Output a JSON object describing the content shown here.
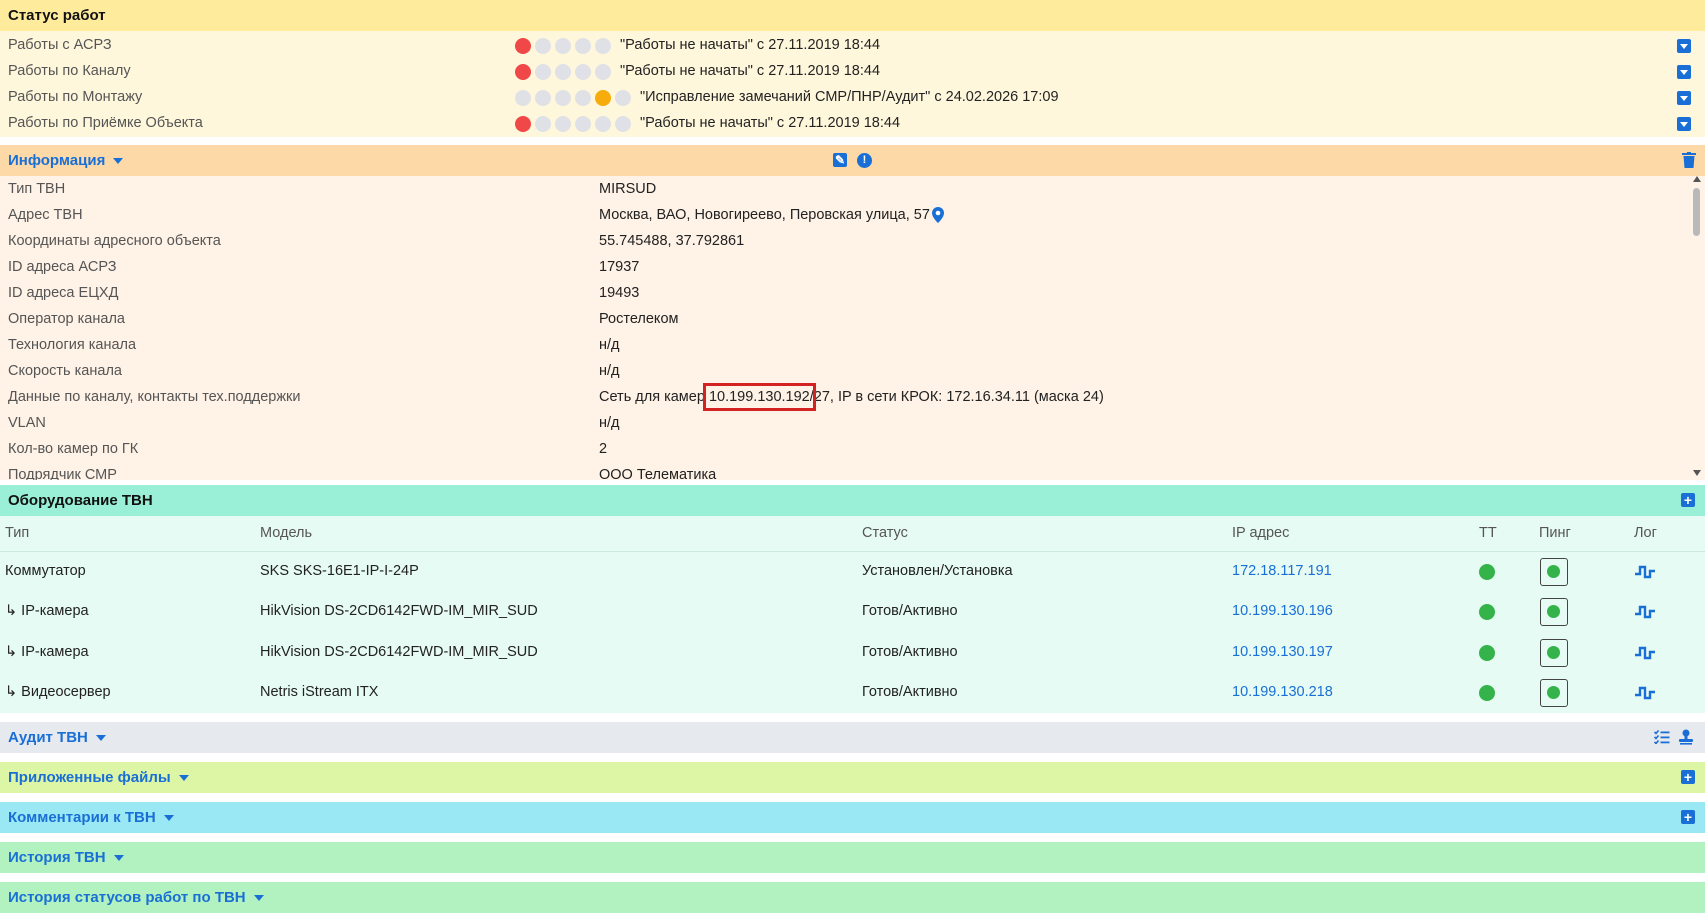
{
  "status_section": {
    "title": "Статус работ",
    "rows": [
      {
        "label": "Работы с АСРЗ",
        "text": "\"Работы не начаты\" с 27.11.2019 18:44"
      },
      {
        "label": "Работы по Каналу",
        "text": "\"Работы не начаты\" с 27.11.2019 18:44"
      },
      {
        "label": "Работы по Монтажу",
        "text": "\"Исправление замечаний СМР/ПНР/Аудит\" с 24.02.2026 17:09"
      },
      {
        "label": "Работы по Приёмке Объекта",
        "text": "\"Работы не начаты\" с 27.11.2019 18:44"
      }
    ]
  },
  "info_section": {
    "title": "Информация",
    "rows": [
      {
        "label": "Тип ТВН",
        "value": "MIRSUD"
      },
      {
        "label": "Адрес ТВН",
        "value": "Москва, ВАО, Новогиреево, Перовская улица, 57"
      },
      {
        "label": "Координаты адресного объекта",
        "value": "55.745488, 37.792861"
      },
      {
        "label": "ID адреса АСРЗ",
        "value": "17937"
      },
      {
        "label": "ID адреса ЕЦХД",
        "value": "19493"
      },
      {
        "label": "Оператор канала",
        "value": "Ростелеком"
      },
      {
        "label": "Технология канала",
        "value": "н/д"
      },
      {
        "label": "Скорость канала",
        "value": "н/д"
      },
      {
        "label": "Данные по каналу, контакты тех.поддержки",
        "value_pre": "Сеть для камер ",
        "value_hl": "10.199.130.192",
        "value_post": "/27, IP в сети КРОК: 172.16.34.11 (маска 24)"
      },
      {
        "label": "VLAN",
        "value": "н/д"
      },
      {
        "label": "Кол-во камер по ГК",
        "value": "2"
      },
      {
        "label": "Подрядчик СМР",
        "value": "ООО Телематика"
      }
    ]
  },
  "equipment_section": {
    "title": "Оборудование ТВН",
    "headers": [
      "Тип",
      "Модель",
      "Статус",
      "IP адрес",
      "ТТ",
      "Пинг",
      "Лог"
    ],
    "rows": [
      {
        "type": "Коммутатор",
        "model": "SKS SKS-16E1-IP-I-24P",
        "status": "Установлен/Установка",
        "ip": "172.18.117.191"
      },
      {
        "type": "↳ IP-камера",
        "model": "HikVision DS-2CD6142FWD-IM_MIR_SUD",
        "status": "Готов/Активно",
        "ip": "10.199.130.196"
      },
      {
        "type": "↳ IP-камера",
        "model": "HikVision DS-2CD6142FWD-IM_MIR_SUD",
        "status": "Готов/Активно",
        "ip": "10.199.130.197"
      },
      {
        "type": "↳ Видеосервер",
        "model": "Netris iStream ITX",
        "status": "Готов/Активно",
        "ip": "10.199.130.218"
      }
    ]
  },
  "collapsed_sections": {
    "audit": "Аудит ТВН",
    "files": "Приложенные файлы",
    "comments": "Комментарии к ТВН",
    "history": "История ТВН",
    "status_history": "История статусов работ по ТВН"
  },
  "colors": {
    "status_bg": "#fff7dc",
    "status_head": "#feeb9c",
    "info_bg": "#fff2e6",
    "info_head": "#fdd9a8",
    "equip_bg": "#e6fbf3",
    "equip_head": "#99f0d6",
    "audit_head": "#e6e9ee",
    "files_head": "#dcf6a6",
    "comments_head": "#99e8f4",
    "history_head": "#b1f2c0",
    "accent": "#1a6fd6",
    "highlight_border": "#d42121"
  }
}
